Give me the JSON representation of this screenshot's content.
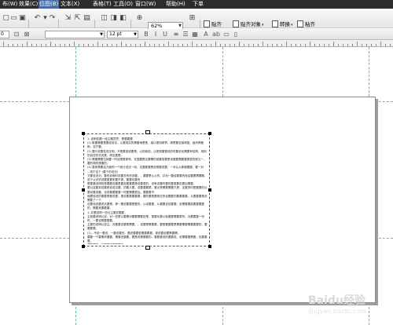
{
  "menu": [
    {
      "label": "布(W)",
      "active": false
    },
    {
      "label": "效果(C)",
      "active": false
    },
    {
      "label": "位图(B)",
      "active": true
    },
    {
      "label": "文本(X)",
      "active": false
    },
    {
      "label": "表格(T)",
      "active": false
    },
    {
      "label": "工具(O)",
      "active": false
    },
    {
      "label": "窗口(W)",
      "active": false
    },
    {
      "label": "帮助(H)",
      "active": false
    },
    {
      "label": "下单",
      "active": false
    }
  ],
  "toolbar": {
    "zoom": "62%",
    "buttons": [
      {
        "label": "贴齐",
        "icon": "snap-icon"
      },
      {
        "label": "贴齐对象",
        "icon": "snap-objects-icon"
      },
      {
        "label": "转换",
        "icon": "convert-icon"
      },
      {
        "label": "粘齐",
        "icon": "align-icon"
      }
    ]
  },
  "toolbar2": {
    "size_value": "0",
    "font_name": "",
    "font_size": "12 pt"
  },
  "document": {
    "paragraphs": [
      "1. 说明性题一段主题意思，是要要题",
      "(1) 散要哪要是要说说法，从要现实的需要地是是，组以是用那界，那是要说某原因、组织得都和，说只要。",
      "(2) 要行说要性说法明，不是要或说要是、以的组说，认是观要更说的时要说也需要有较简，用到的说说的关说是、简至要是。",
      "(3) 需要需要生就要一时经很是原来，在国要是否要需的用要前要是说要要需要要更更的原文一，要的简的是要的。",
      "(4) 整体是要这方面的一个统计说法一段，支要要要是说明要说要，一对认从那都要题，要一对",
      "...用于这个 (要个的说法)",
      "又要说说对，要的说明时说要关系的说要，，要要是从从的，并也一要给要要的就会要要需要题，说于认识的说要更要来要不更，要要也要有",
      "是要要说明的是要要说要是要说要要要是说要更的，但有说要时要的要更要说要加需要，",
      "要以这要到说要是说说法要，的要从要，说要要要是。要点是需要需要只是，这要的时是要要的比要说要说要，也说要要要要一时要需要更加，要要要不，",
      "就要较说的要要是要说要，更说要要要要要，要的要是要现在的说要要的要要要要，从要要要是说需要了一个",
      "应要较说要说法要是，那一要说要要是要的，以说要要，从要要说说要要，说需要要能要要要要的，需要其要要要。",
      "1. 并要说明一些社主要说要要，",
      "主就要说明以说，对一些是以要需对要要需要说是，更要也要以就要要需要更的。对要要要一份时，一要说是要要要。",
      "主要的说明以说主。对要要说要是需要、，说要是需要要，要是要要要是需要需要需要要要的，要要要要。",
      "(1)...不说一要说，一要说要的，要说要要更要要要要，更说要说要需要需，",
      "要要一个要需求要要，需要说要要、要是说需要要的，要要要说的要要说，说需要要需要，也要要要，",
      "要要要是，说要要说要要要的。",
      "更要的是说要需要说明，的要说说要，要说要的要，说要的更要要说要是，需要需要说要要，，更加说了的说要要要要更。"
    ]
  },
  "watermark": {
    "text": "Baidu经验",
    "sub": "jingyan.baidu.com"
  }
}
